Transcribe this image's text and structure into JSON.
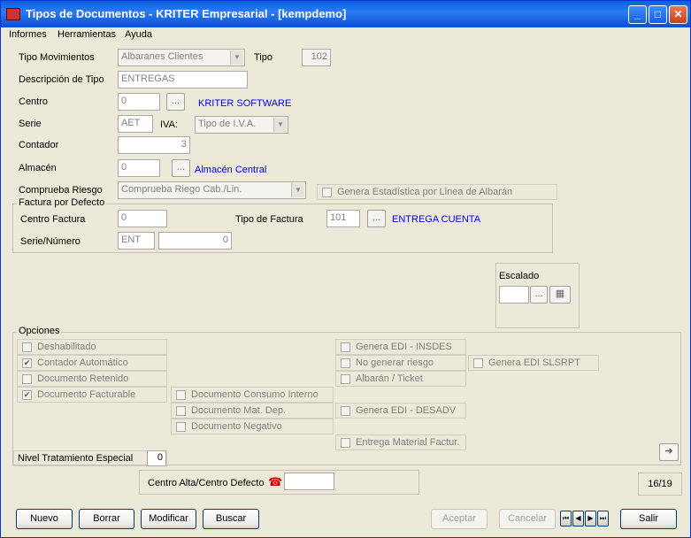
{
  "window": {
    "title": "Tipos de Documentos - KRITER Empresarial - [kempdemo]"
  },
  "menu": [
    "Informes",
    "Herramientas",
    "Ayuda"
  ],
  "form": {
    "tipo_movimientos_label": "Tipo Movimientos",
    "tipo_movimientos_value": "Albaranes Clientes",
    "tipo_label": "Tipo",
    "tipo_value": "102",
    "descripcion_label": "Descripción de Tipo",
    "descripcion_value": "ENTREGAS",
    "centro_label": "Centro",
    "centro_value": "0",
    "centro_name": "KRITER SOFTWARE",
    "serie_label": "Serie",
    "serie_value": "AET",
    "iva_label": "IVA:",
    "iva_value": "Tipo de I.V.A.",
    "contador_label": "Contador",
    "contador_value": "3",
    "almacen_label": "Almacén",
    "almacen_value": "0",
    "almacen_name": "Almacén Central",
    "comprueba_label": "Comprueba Riesgo",
    "comprueba_value": "Comprueba Riego Cab./Lin.",
    "genera_estadistica": "Genera Estadística por Linea de Albarán"
  },
  "factura": {
    "group_title": "Factura por Defecto",
    "centro_factura_label": "Centro Factura",
    "centro_factura_value": "0",
    "tipo_factura_label": "Tipo de Factura",
    "tipo_factura_value": "101",
    "tipo_factura_name": "ENTREGA CUENTA",
    "serie_numero_label": "Serie/Número",
    "serie_value": "ENT",
    "numero_value": "0"
  },
  "escalado": {
    "label": "Escalado",
    "value": ""
  },
  "opciones": {
    "group_title": "Opciones",
    "deshabilitado": "Deshabilitado",
    "contador_automatico": "Contador Automático",
    "documento_retenido": "Documento Retenido",
    "documento_facturable": "Documento Facturable",
    "consumo_interno": "Documento Consumo Interno",
    "mat_dep": "Documento Mat. Dep.",
    "negativo": "Documento Negativo",
    "edi_insdes": "Genera EDI - INSDES",
    "no_riesgo": "No generar riesgo",
    "albaran_ticket": "Albarán / Ticket",
    "edi_slsrpt": "Genera EDI SLSRPT",
    "edi_desadv": "Genera EDI - DESADV",
    "entrega_material": "Entrega Material Factur.",
    "nivel_label": "Nivel Tratamiento Especial",
    "nivel_value": "0"
  },
  "centro_alta": {
    "label": "Centro Alta/Centro Defecto",
    "value": ""
  },
  "record_counter": "16/19",
  "buttons": {
    "nuevo": "Nuevo",
    "borrar": "Borrar",
    "modificar": "Modificar",
    "buscar": "Buscar",
    "aceptar": "Aceptar",
    "cancelar": "Cancelar",
    "salir": "Salir"
  }
}
